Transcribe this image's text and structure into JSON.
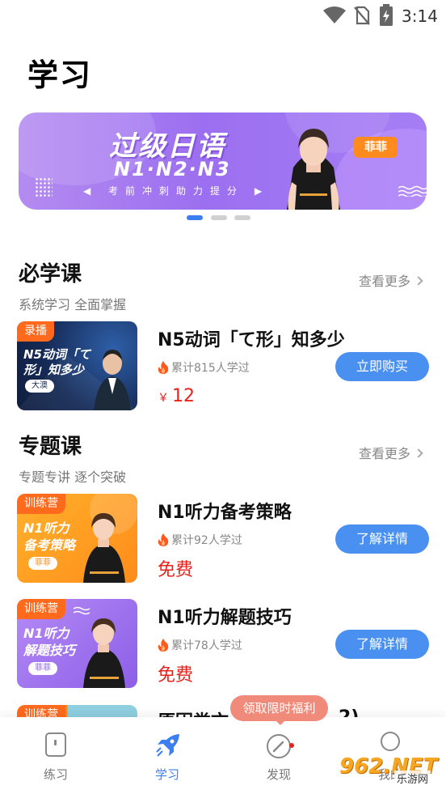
{
  "status_bar": {
    "time": "3:14"
  },
  "page_title": "学习",
  "banner": {
    "headline": "过级日语",
    "levels": "N1·N2·N3",
    "slogan": "◀ 考前冲刺助力提分 ▶",
    "teacher_tag": "菲菲"
  },
  "required": {
    "title": "必学课",
    "subtitle": "系统学习 全面掌握",
    "more": "查看更多",
    "courses": [
      {
        "badge": "录播",
        "thumb_title": "N5动词「て形」知多少",
        "thumb_tag": "大澳",
        "title": "N5动词「て形」知多少",
        "learners": "累计815人学过",
        "price_symbol": "￥",
        "price": "12",
        "button": "立即购买"
      }
    ]
  },
  "topic": {
    "title": "专题课",
    "subtitle": "专题专讲 逐个突破",
    "more": "查看更多",
    "courses": [
      {
        "badge": "训练营",
        "thumb_title": "N1听力备考策略",
        "thumb_tag": "菲菲",
        "title": "N1听力备考策略",
        "learners": "累计92人学过",
        "price": "免费",
        "button": "了解详情"
      },
      {
        "badge": "训练营",
        "thumb_title": "N1听力解题技巧",
        "thumb_tag": "菲菲",
        "title": "N1听力解题技巧",
        "learners": "累计78人学过",
        "price": "免费",
        "button": "了解详情"
      },
      {
        "badge": "训练营",
        "title": "原因类文",
        "title_tail": "2)"
      }
    ]
  },
  "promo": "领取限时福利",
  "bottom_nav": [
    {
      "label": "练习",
      "icon": "practice-icon",
      "active": false
    },
    {
      "label": "学习",
      "icon": "rocket-icon",
      "active": true
    },
    {
      "label": "发现",
      "icon": "compass-icon",
      "active": false
    },
    {
      "label": "我的",
      "icon": "profile-icon",
      "active": false
    }
  ],
  "watermark": {
    "logo": "962.NET",
    "text": "乐游网"
  },
  "colors": {
    "accent": "#4a90f0",
    "price": "#e8211a",
    "badge": "#ff6a1d",
    "nav_active": "#3c7df0"
  }
}
